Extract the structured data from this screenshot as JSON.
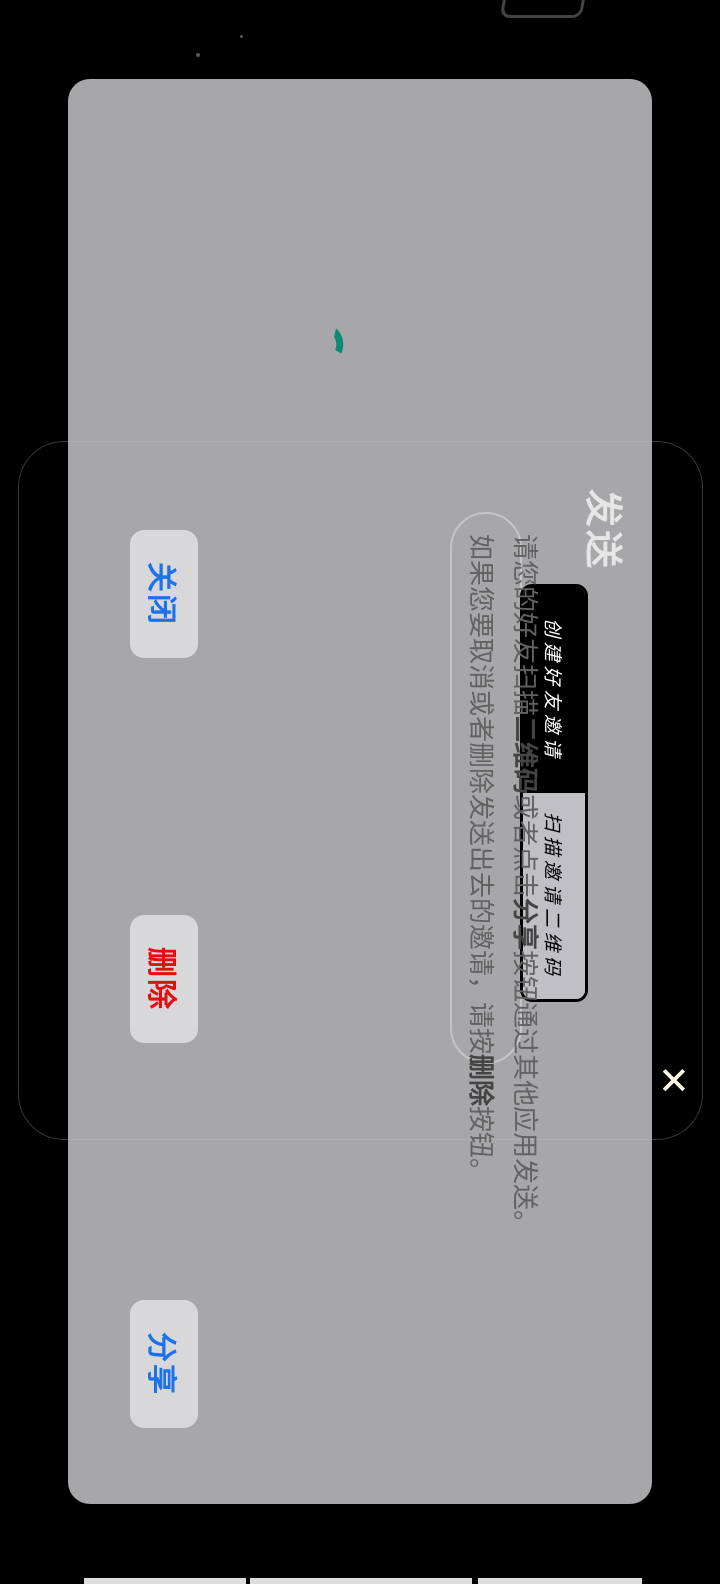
{
  "modal": {
    "title": "发送",
    "tabs": [
      {
        "label": "创建好友邀请",
        "active": true
      },
      {
        "label": "扫描邀请二维码",
        "active": false
      }
    ],
    "message": {
      "line1_a": "请您的好友扫描",
      "line1_b": "二维码",
      "line1_c": "或者点击",
      "line1_d": "分享",
      "line1_e": "按钮通过其他应用发送。",
      "line2_a": "如果您要取消或者删除发送出去的邀请，请按",
      "line2_b": "删除",
      "line2_c": "按钮。"
    },
    "buttons": {
      "close": "关闭",
      "delete": "删除",
      "share": "分享"
    }
  },
  "background": {
    "close_icon_glyph": "✕"
  },
  "colors": {
    "accent_blue": "#1a73e8",
    "danger_red": "#e01010",
    "spinner_teal": "#0b8a74"
  }
}
